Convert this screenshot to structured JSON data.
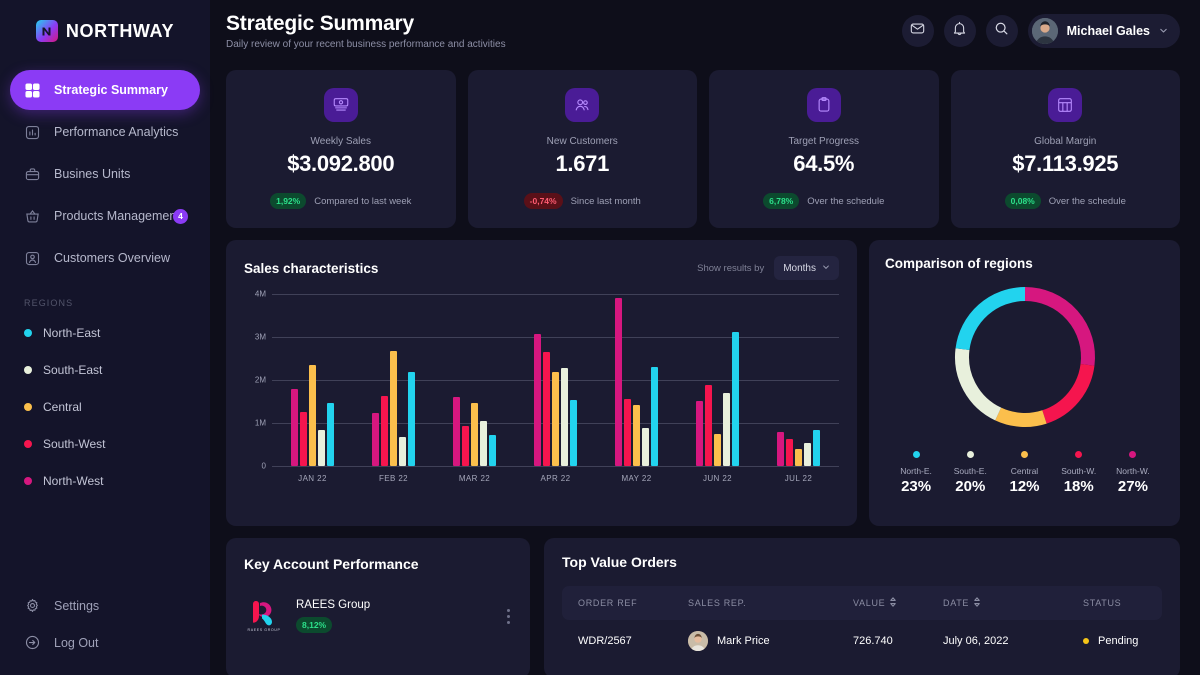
{
  "brand": {
    "name": "NORTHWAY",
    "mark_icon": "northway-n-logo"
  },
  "sidebar": {
    "nav": [
      {
        "label": "Strategic Summary",
        "icon": "grid-icon",
        "active": true
      },
      {
        "label": "Performance Analytics",
        "icon": "bar-chart-icon",
        "active": false
      },
      {
        "label": "Busines Units",
        "icon": "briefcase-icon",
        "active": false
      },
      {
        "label": "Products Management",
        "icon": "basket-icon",
        "active": false,
        "badge": "4"
      },
      {
        "label": "Customers Overview",
        "icon": "user-square-icon",
        "active": false
      }
    ],
    "regions_label": "REGIONS",
    "regions": [
      {
        "label": "North-East",
        "color": "#22D3EE"
      },
      {
        "label": "South-East",
        "color": "#E8F0DC"
      },
      {
        "label": "Central",
        "color": "#FBBF4C"
      },
      {
        "label": "South-West",
        "color": "#F5154E"
      },
      {
        "label": "North-West",
        "color": "#D6177F"
      }
    ],
    "bottom": [
      {
        "label": "Settings",
        "icon": "gear-icon"
      },
      {
        "label": "Log Out",
        "icon": "logout-icon"
      }
    ]
  },
  "header": {
    "title": "Strategic Summary",
    "subtitle": "Daily review of your recent business performance and activities",
    "actions": [
      {
        "icon": "mail-icon"
      },
      {
        "icon": "bell-icon"
      },
      {
        "icon": "search-icon"
      }
    ],
    "user": {
      "name": "Michael Gales",
      "avatar_icon": "user-avatar",
      "chevron_icon": "chevron-down-icon"
    }
  },
  "kpis": [
    {
      "icon": "money-icon",
      "label": "Weekly Sales",
      "value": "$3.092.800",
      "delta": "1,92%",
      "direction": "up",
      "note": "Compared to last week"
    },
    {
      "icon": "users-icon",
      "label": "New Customers",
      "value": "1.671",
      "delta": "-0,74%",
      "direction": "down",
      "note": "Since last month"
    },
    {
      "icon": "clipboard-icon",
      "label": "Target Progress",
      "value": "64.5%",
      "delta": "6,78%",
      "direction": "up",
      "note": "Over the schedule"
    },
    {
      "icon": "table-icon",
      "label": "Global Margin",
      "value": "$7.113.925",
      "delta": "0,08%",
      "direction": "up",
      "note": "Over the schedule"
    }
  ],
  "sales_chart": {
    "title": "Sales characteristics",
    "show_results_by_label": "Show results by",
    "selected_period": "Months",
    "chevron_icon": "chevron-down-icon"
  },
  "regions_chart": {
    "title": "Comparison of regions"
  },
  "key_accounts": {
    "title": "Key Account Performance",
    "rows": [
      {
        "logo_icon": "raees-group-logo",
        "logo_sub": "RAEES GROUP",
        "name": "RAEES Group",
        "delta": "8,12%",
        "direction": "up",
        "menu_icon": "kebab-menu-icon"
      }
    ]
  },
  "orders": {
    "title": "Top Value Orders",
    "columns": [
      {
        "label": "ORDER REF",
        "sortable": false
      },
      {
        "label": "SALES REP.",
        "sortable": false
      },
      {
        "label": "VALUE",
        "sortable": true,
        "sort_icon": "sort-icon"
      },
      {
        "label": "DATE",
        "sortable": true,
        "sort_icon": "sort-icon"
      },
      {
        "label": "STATUS",
        "sortable": false
      }
    ],
    "rows": [
      {
        "ref": "WDR/2567",
        "rep": "Mark Price",
        "rep_avatar_icon": "user-avatar",
        "value": "726.740",
        "date": "July 06, 2022",
        "status": "Pending",
        "status_color": "#F5C518"
      }
    ]
  },
  "chart_data": [
    {
      "type": "bar",
      "title": "Sales characteristics",
      "xlabel": "",
      "ylabel": "",
      "ylim": [
        0,
        4000000
      ],
      "yticks": [
        0,
        1000000,
        2000000,
        3000000,
        4000000
      ],
      "ytick_labels": [
        "0",
        "1M",
        "2M",
        "3M",
        "4M"
      ],
      "grid": true,
      "legend_position": "sidebar",
      "categories": [
        "JAN 22",
        "FEB 22",
        "MAR 22",
        "APR 22",
        "MAY 22",
        "JUN 22",
        "JUL 22"
      ],
      "series": [
        {
          "name": "North-West",
          "color": "#D6177F",
          "values": [
            1780000,
            1230000,
            1610000,
            3060000,
            3910000,
            1520000,
            800000
          ]
        },
        {
          "name": "South-West",
          "color": "#F5154E",
          "values": [
            1250000,
            1620000,
            920000,
            2640000,
            1550000,
            1880000,
            620000
          ]
        },
        {
          "name": "Central",
          "color": "#FBBF4C",
          "values": [
            2340000,
            2680000,
            1470000,
            2180000,
            1410000,
            740000,
            390000
          ]
        },
        {
          "name": "South-East",
          "color": "#E8F0DC",
          "values": [
            840000,
            680000,
            1040000,
            2290000,
            890000,
            1700000,
            540000
          ]
        },
        {
          "name": "North-East",
          "color": "#22D3EE",
          "values": [
            1460000,
            2180000,
            720000,
            1530000,
            2300000,
            3120000,
            840000
          ]
        }
      ]
    },
    {
      "type": "pie",
      "variant": "donut",
      "title": "Comparison of regions",
      "start_angle_deg": 0,
      "labels": [
        "North-West",
        "South-West",
        "Central",
        "South-East",
        "North-East"
      ],
      "values": [
        27,
        18,
        12,
        20,
        23
      ],
      "colors": [
        "#D6177F",
        "#F5154E",
        "#FBBF4C",
        "#E8F0DC",
        "#22D3EE"
      ],
      "legend": [
        {
          "name": "North-E.",
          "value": "23%",
          "color": "#22D3EE"
        },
        {
          "name": "South-E.",
          "value": "20%",
          "color": "#E8F0DC"
        },
        {
          "name": "Central",
          "value": "12%",
          "color": "#FBBF4C"
        },
        {
          "name": "South-W.",
          "value": "18%",
          "color": "#F5154E"
        },
        {
          "name": "North-W.",
          "value": "27%",
          "color": "#D6177F"
        }
      ]
    }
  ]
}
